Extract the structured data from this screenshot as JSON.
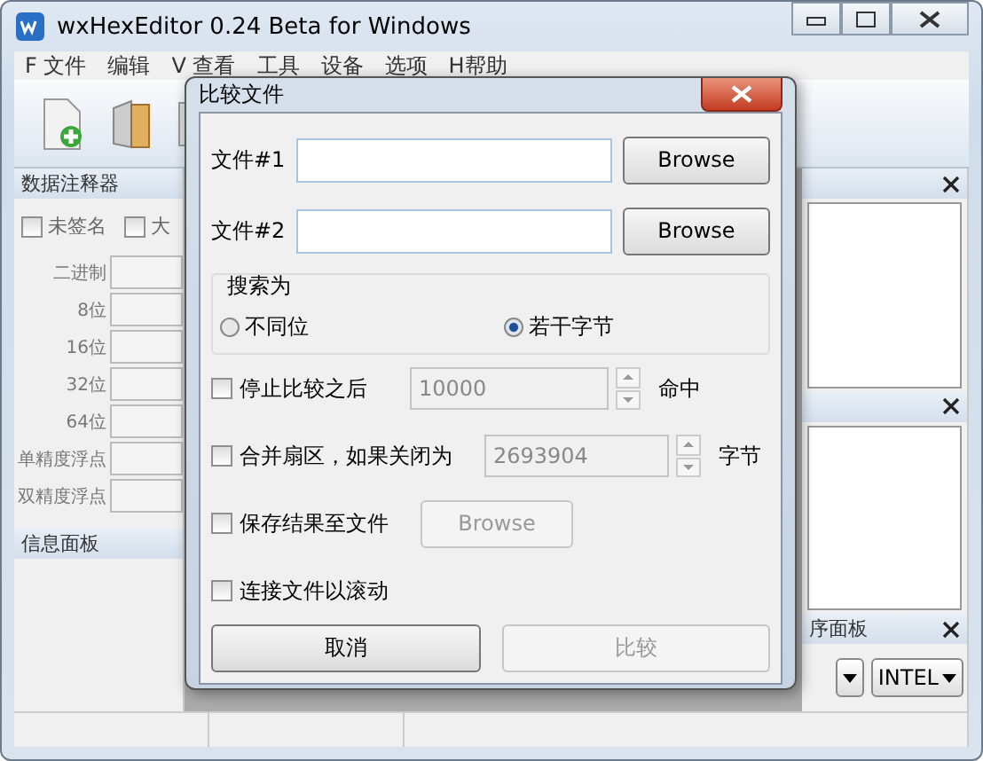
{
  "window": {
    "title": "wxHexEditor 0.24 Beta for Windows"
  },
  "menu": [
    "F 文件",
    "编辑",
    "V 查看",
    "工具",
    "设备",
    "选项",
    "H帮助"
  ],
  "annotator": {
    "title": "数据注释器",
    "checkboxes": [
      {
        "label": "未签名",
        "checked": false
      },
      {
        "label": "大",
        "checked": false
      }
    ],
    "rows": [
      "二进制",
      "8位",
      "16位",
      "32位",
      "64位",
      "单精度浮点",
      "双精度浮点"
    ]
  },
  "info_panel": {
    "title": "信息面板"
  },
  "program_panel": {
    "title": "序面板",
    "dropdowns": [
      {
        "kind": "blank"
      },
      {
        "kind": "text",
        "value": "INTEL"
      }
    ]
  },
  "dialog": {
    "title": "比较文件",
    "files": [
      {
        "label": "文件#1",
        "button": "Browse"
      },
      {
        "label": "文件#2",
        "button": "Browse"
      }
    ],
    "search_group": {
      "title": "搜索为",
      "options": [
        {
          "label": "不同位",
          "selected": false
        },
        {
          "label": "若干字节",
          "selected": true
        }
      ]
    },
    "options": [
      {
        "label": "停止比较之后",
        "checked": false,
        "kind": "spin",
        "value": "10000",
        "unit": "命中"
      },
      {
        "label": "合并扇区，如果关闭为",
        "checked": false,
        "kind": "spin",
        "value": "2693904",
        "unit": "字节"
      },
      {
        "label": "保存结果至文件",
        "checked": false,
        "kind": "button",
        "button": "Browse"
      },
      {
        "label": "连接文件以滚动",
        "checked": false,
        "kind": "plain"
      }
    ],
    "buttons": [
      {
        "label": "取消",
        "disabled": false
      },
      {
        "label": "比较",
        "disabled": true
      }
    ]
  }
}
